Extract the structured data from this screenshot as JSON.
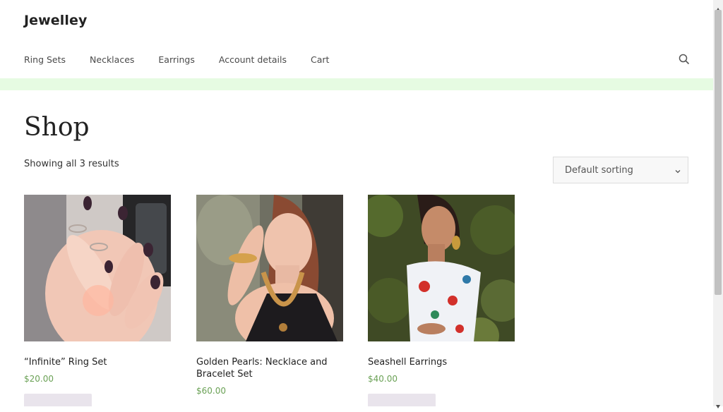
{
  "site": {
    "title": "Jewelley"
  },
  "nav": {
    "items": [
      {
        "label": "Ring Sets"
      },
      {
        "label": "Necklaces"
      },
      {
        "label": "Earrings"
      },
      {
        "label": "Account details"
      },
      {
        "label": "Cart"
      }
    ]
  },
  "icons": {
    "search": "search-icon",
    "chevron": "chevron-down-icon"
  },
  "colors": {
    "band": "#e6fbe2",
    "price": "#6aa155",
    "button": "#e9e4ec"
  },
  "main": {
    "heading": "Shop",
    "result_count": "Showing all 3 results",
    "sort": {
      "selected": "Default sorting"
    }
  },
  "products": [
    {
      "name": "“Infinite” Ring Set",
      "price": "$20.00"
    },
    {
      "name": "Golden Pearls: Necklace and Bracelet Set",
      "price": "$60.00"
    },
    {
      "name": "Seashell Earrings",
      "price": "$40.00"
    }
  ]
}
